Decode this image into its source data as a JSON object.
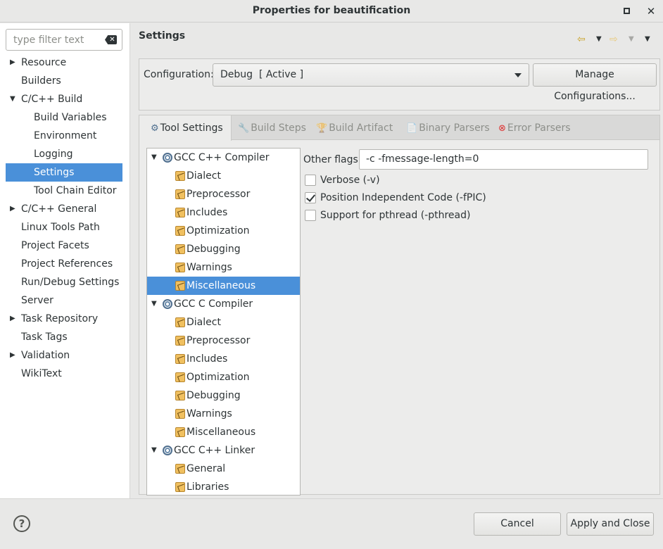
{
  "window": {
    "title": "Properties for beautification",
    "maximize_icon": "maximize-icon",
    "close_icon": "close-icon"
  },
  "filter": {
    "placeholder": "type filter text"
  },
  "nav": {
    "items": [
      {
        "label": "Resource",
        "expander": "▶"
      },
      {
        "label": "Builders",
        "expander": ""
      },
      {
        "label": "C/C++ Build",
        "expander": "▼"
      },
      {
        "label": "Build Variables",
        "expander": ""
      },
      {
        "label": "Environment",
        "expander": ""
      },
      {
        "label": "Logging",
        "expander": ""
      },
      {
        "label": "Settings",
        "expander": "",
        "selected": true
      },
      {
        "label": "Tool Chain Editor",
        "expander": ""
      },
      {
        "label": "C/C++ General",
        "expander": "▶"
      },
      {
        "label": "Linux Tools Path",
        "expander": ""
      },
      {
        "label": "Project Facets",
        "expander": ""
      },
      {
        "label": "Project References",
        "expander": ""
      },
      {
        "label": "Run/Debug Settings",
        "expander": ""
      },
      {
        "label": "Server",
        "expander": ""
      },
      {
        "label": "Task Repository",
        "expander": "▶"
      },
      {
        "label": "Task Tags",
        "expander": ""
      },
      {
        "label": "Validation",
        "expander": "▶"
      },
      {
        "label": "WikiText",
        "expander": ""
      }
    ]
  },
  "header": {
    "title": "Settings",
    "back_arrow": "⇦",
    "forward_arrow": "⇨",
    "dropdown": "▼"
  },
  "config": {
    "label": "Configuration:",
    "value": "Debug  [ Active ]",
    "manage_label": "Manage Configurations..."
  },
  "tabs": [
    {
      "label": "Tool Settings",
      "icon": "⚙"
    },
    {
      "label": "Build Steps",
      "icon": "🔧"
    },
    {
      "label": "Build Artifact",
      "icon": "🏆"
    },
    {
      "label": "Binary Parsers",
      "icon": "📄"
    },
    {
      "label": "Error Parsers",
      "icon": "⊗"
    }
  ],
  "tooltree": {
    "items": [
      {
        "label": "GCC C++ Compiler",
        "expander": "▼"
      },
      {
        "label": "Dialect"
      },
      {
        "label": "Preprocessor"
      },
      {
        "label": "Includes"
      },
      {
        "label": "Optimization"
      },
      {
        "label": "Debugging"
      },
      {
        "label": "Warnings"
      },
      {
        "label": "Miscellaneous",
        "selected": true
      },
      {
        "label": "GCC C Compiler",
        "expander": "▼"
      },
      {
        "label": "Dialect"
      },
      {
        "label": "Preprocessor"
      },
      {
        "label": "Includes"
      },
      {
        "label": "Optimization"
      },
      {
        "label": "Debugging"
      },
      {
        "label": "Warnings"
      },
      {
        "label": "Miscellaneous"
      },
      {
        "label": "GCC C++ Linker",
        "expander": "▼"
      },
      {
        "label": "General"
      },
      {
        "label": "Libraries"
      }
    ]
  },
  "misc": {
    "other_flags_label": "Other flags",
    "other_flags_value": "-c -fmessage-length=0",
    "verbose_label": "Verbose (-v)",
    "verbose_checked": false,
    "pic_label": "Position Independent Code (-fPIC)",
    "pic_checked": true,
    "pthread_label": "Support for pthread (-pthread)",
    "pthread_checked": false
  },
  "footer": {
    "help": "?",
    "cancel_label": "Cancel",
    "apply_label": "Apply and Close"
  }
}
